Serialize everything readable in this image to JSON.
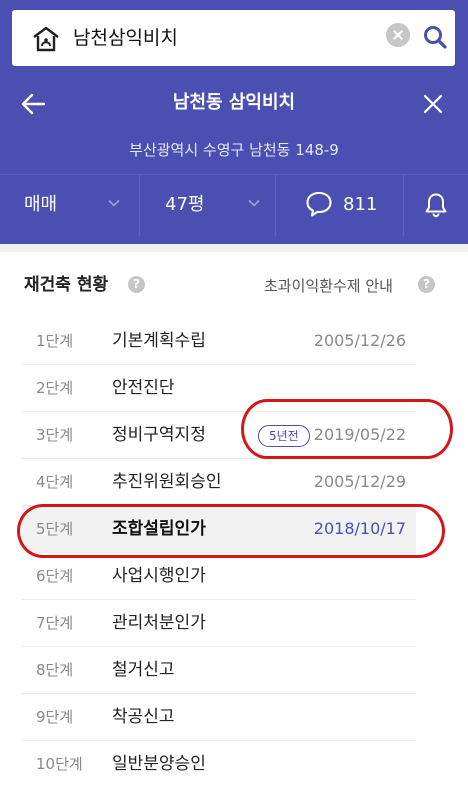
{
  "search": {
    "query": "남천삼익비치"
  },
  "nav": {
    "title": "남천동 삼익비치"
  },
  "address": "부산광역시 수영구 남천동 148-9",
  "filters": {
    "trade_type": "매매",
    "size": "47평",
    "comment_count": "811"
  },
  "section": {
    "title": "재건축 현황",
    "link": "초과이익환수제 안내"
  },
  "steps": [
    {
      "step": "1단계",
      "name": "기본계획수립",
      "date": "2005/12/26"
    },
    {
      "step": "2단계",
      "name": "안전진단",
      "date": ""
    },
    {
      "step": "3단계",
      "name": "정비구역지정",
      "date": "2019/05/22",
      "badge": "5년전"
    },
    {
      "step": "4단계",
      "name": "추진위원회승인",
      "date": "2005/12/29"
    },
    {
      "step": "5단계",
      "name": "조합설립인가",
      "date": "2018/10/17"
    },
    {
      "step": "6단계",
      "name": "사업시행인가",
      "date": ""
    },
    {
      "step": "7단계",
      "name": "관리처분인가",
      "date": ""
    },
    {
      "step": "8단계",
      "name": "철거신고",
      "date": ""
    },
    {
      "step": "9단계",
      "name": "착공신고",
      "date": ""
    },
    {
      "step": "10단계",
      "name": "일반분양승인",
      "date": ""
    }
  ],
  "help_glyph": "?",
  "colors": {
    "brand": "#4a4fb1",
    "annotation": "#d8141b"
  }
}
